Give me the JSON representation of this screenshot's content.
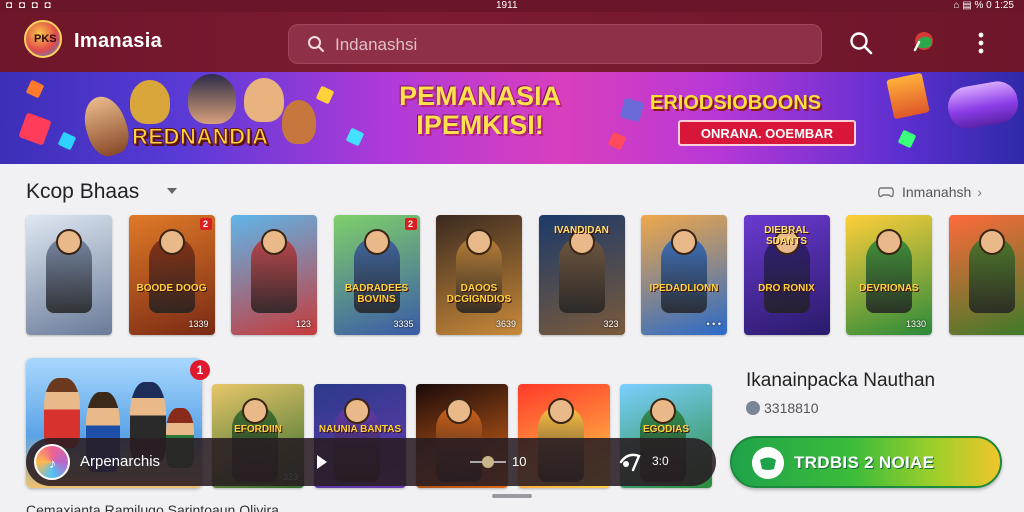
{
  "status": {
    "left": "◘ ◘ ◘ ◘",
    "time": "1911",
    "right": "⌂ ▤ % 0 1:25"
  },
  "app": {
    "logo_text": "PKS",
    "title": "Imanasia"
  },
  "search": {
    "placeholder": "Indanashsi"
  },
  "banner": {
    "left_title": "REDNANDIA",
    "main_line1": "PEMANASIA",
    "main_line2": "IPEMKISI!",
    "promo_title": "ERIODSIOBOONS",
    "promo_subtitle": "ONRANA. OOEMBAR"
  },
  "section": {
    "title": "Kcop Bhaas",
    "see_all": "Inmanahsh"
  },
  "cards": [
    {
      "top": "",
      "title": "",
      "meta": "",
      "badge": ""
    },
    {
      "top": "",
      "title": "BOODE DOOG",
      "meta": "1339",
      "badge": "2"
    },
    {
      "top": "",
      "title": "",
      "meta": "123",
      "badge": ""
    },
    {
      "top": "",
      "title": "BADRADEES BOVINS",
      "meta": "3335",
      "badge": "2"
    },
    {
      "top": "",
      "title": "DAOOS DCGIGNDIOS",
      "meta": "3639",
      "badge": ""
    },
    {
      "top": "IVANDIDAN",
      "title": "",
      "meta": "323",
      "badge": ""
    },
    {
      "top": "",
      "title": "IPEDADLIONN",
      "meta": "• • •",
      "badge": ""
    },
    {
      "top": "DIEBRAL SDANTS",
      "title": "DRO RONIX",
      "meta": "",
      "badge": ""
    },
    {
      "top": "",
      "title": "DEVRIONAS",
      "meta": "1330",
      "badge": ""
    },
    {
      "top": "",
      "title": "",
      "meta": "",
      "badge": ""
    }
  ],
  "row2_cards": [
    {
      "title": "EFORDIIN",
      "meta": "323"
    },
    {
      "title": "NAUNIA BANTAS",
      "meta": ""
    },
    {
      "title": "",
      "meta": ""
    },
    {
      "title": "",
      "meta": ""
    },
    {
      "title": "EGODIAS",
      "meta": ""
    }
  ],
  "featured": {
    "badge": "1",
    "title": "Ikanainpacka Nauthan",
    "meta": "3318810"
  },
  "install": {
    "label": "TRDBIS 2 NOIAE"
  },
  "player": {
    "app_icon": "♪",
    "name": "Arpenarchis",
    "volume_label": "10",
    "time_label": "3:0"
  },
  "footer": {
    "text": "Cemaxianta Ramilugo Sarintoaun Olivira"
  },
  "colors": {
    "header": "#6e1629",
    "accent_green": "#1fa34a",
    "accent_yellow": "#f0c52a"
  },
  "icons": [
    "search-icon",
    "flag-icon",
    "more-vertical-icon",
    "chevron-down-icon",
    "chevron-right-icon",
    "play-icon",
    "cast-icon",
    "volume-icon"
  ]
}
